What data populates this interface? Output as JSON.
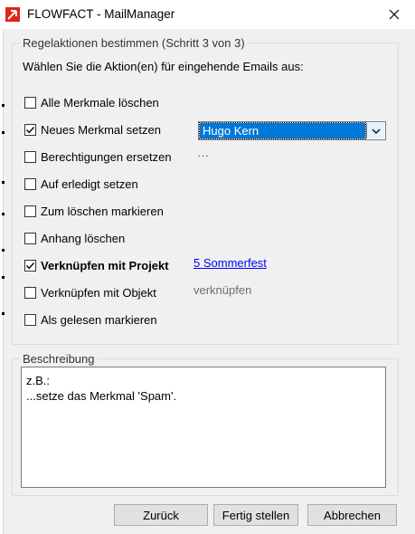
{
  "window": {
    "title": "FLOWFACT - MailManager",
    "brand_color": "#e2231a",
    "accent_color": "#0078d7"
  },
  "rule_actions": {
    "group_title": "Regelaktionen bestimmen (Schritt 3 von 3)",
    "instruction": "Wählen Sie die Aktion(en) für eingehende Emails aus:",
    "actions": [
      {
        "label": "Alle Merkmale löschen",
        "checked": false
      },
      {
        "label": "Neues Merkmal setzen",
        "checked": true
      },
      {
        "label": "Berechtigungen ersetzen",
        "checked": false
      },
      {
        "label": "Auf erledigt setzen",
        "checked": false
      },
      {
        "label": "Zum löschen markieren",
        "checked": false
      },
      {
        "label": "Anhang löschen",
        "checked": false
      },
      {
        "label": "Verknüpfen mit Projekt",
        "checked": true
      },
      {
        "label": "Verknüpfen mit Objekt",
        "checked": false
      },
      {
        "label": "Als gelesen markieren",
        "checked": false
      }
    ],
    "merkmal_select": {
      "value": "Hugo Kern",
      "icon": "chevron-down-icon"
    },
    "berechtigungen_more": "···",
    "project_link": "5 Sommerfest",
    "objekt_link": "verknüpfen"
  },
  "description": {
    "group_title": "Beschreibung",
    "lines": [
      "z.B.:",
      "...setze das Merkmal 'Spam'."
    ]
  },
  "buttons": {
    "back": "Zurück",
    "finish": "Fertig stellen",
    "cancel": "Abbrechen"
  }
}
